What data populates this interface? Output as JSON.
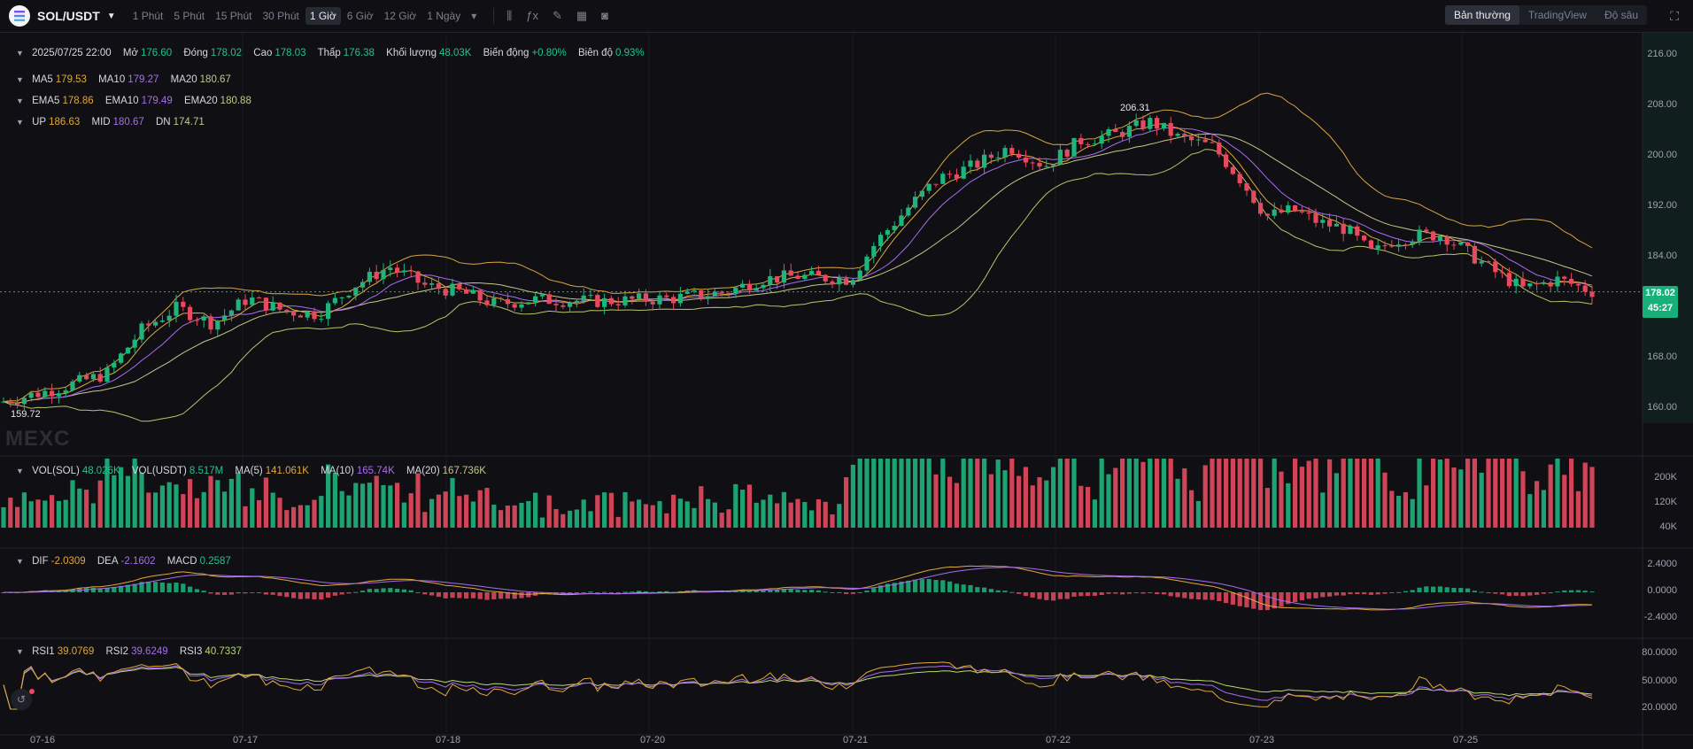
{
  "header": {
    "pair": "SOL/USDT",
    "intervals": [
      "1 Phút",
      "5 Phút",
      "15 Phút",
      "30 Phút",
      "1 Giờ",
      "6 Giờ",
      "12 Giờ",
      "1 Ngày"
    ],
    "active_interval": "1 Giờ",
    "tool_icons": [
      "candle-type-icon",
      "indicator-icon",
      "draw-icon",
      "layout-icon",
      "camera-icon"
    ],
    "views": [
      "Bản thường",
      "TradingView",
      "Độ sâu"
    ],
    "active_view": "Bản thường"
  },
  "ohlc": {
    "time": "2025/07/25 22:00",
    "open_label": "Mở",
    "open": "176.60",
    "close_label": "Đóng",
    "close": "178.02",
    "high_label": "Cao",
    "high": "178.03",
    "low_label": "Thấp",
    "low": "176.38",
    "volume_label": "Khối lượng",
    "volume": "48.03K",
    "change_label": "Biến động",
    "change": "+0.80%",
    "amplitude_label": "Biên độ",
    "amplitude": "0.93%"
  },
  "ma": {
    "ma5": "179.53",
    "ma10": "179.27",
    "ma20": "180.67"
  },
  "ema": {
    "ema5": "178.86",
    "ema10": "179.49",
    "ema20": "180.88"
  },
  "boll": {
    "up": "186.63",
    "mid": "180.67",
    "dn": "174.71"
  },
  "vol": {
    "sol": "48.026K",
    "usdt": "8.517M",
    "ma5": "141.061K",
    "ma10": "165.74K",
    "ma20": "167.736K"
  },
  "macd": {
    "dif": "-2.0309",
    "dea": "-2.1602",
    "macd": "0.2587"
  },
  "rsi": {
    "rsi1": "39.0769",
    "rsi2": "39.6249",
    "rsi3": "40.7337"
  },
  "price_axis": [
    "216.00",
    "208.00",
    "200.00",
    "192.00",
    "184.00",
    "176.00",
    "168.00",
    "160.00"
  ],
  "vol_axis": [
    "200K",
    "120K",
    "40K"
  ],
  "macd_axis": [
    "2.4000",
    "0.0000",
    "-2.4000"
  ],
  "rsi_axis": [
    "80.0000",
    "50.0000",
    "20.0000"
  ],
  "x_axis": [
    "07-16",
    "07-17",
    "07-18",
    "07-20",
    "07-21",
    "07-22",
    "07-23",
    "07-25"
  ],
  "last_price": "178.02",
  "countdown": "45:27",
  "high_marker": "206.31",
  "low_marker": "159.72",
  "watermark": "MEXC",
  "colors": {
    "up": "#1fb47c",
    "down": "#e64a5e",
    "bg": "#101014",
    "ma5": "#e0a83b",
    "ma10": "#a86cf0",
    "ma20": "#c4c78a"
  }
}
